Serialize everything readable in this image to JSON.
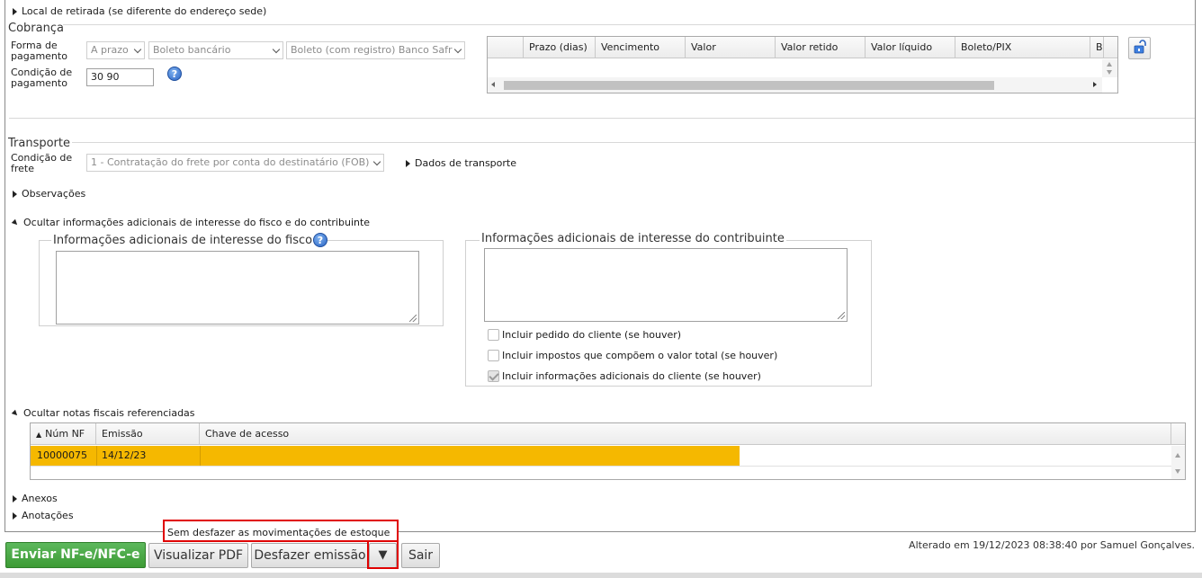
{
  "top_toggle": {
    "label": "Local de retirada (se diferente do endereço sede)"
  },
  "cobranca": {
    "title": "Cobrança",
    "forma_label": "Forma de pagamento",
    "forma_value": "A prazo",
    "tipo_value": "Boleto bancário",
    "banco_value": "Boleto (com registro) Banco Safr",
    "condicao_label": "Condição de pagamento",
    "condicao_value": "30 90",
    "help_icon": "question-icon",
    "columns": [
      "Prazo (dias)",
      "Vencimento",
      "Valor",
      "Valor retido",
      "Valor líquido",
      "Boleto/PIX",
      "B"
    ],
    "lock_icon": "lock-icon"
  },
  "transporte": {
    "title": "Transporte",
    "frete_label": "Condição de frete",
    "frete_value": "1 - Contratação do frete por conta do destinatário (FOB)",
    "dados_label": "Dados de transporte"
  },
  "observacoes": {
    "label": "Observações"
  },
  "info_adicionais": {
    "toggle_label": "Ocultar informações adicionais de interesse do fisco e do contribuinte",
    "fisco_title": "Informações adicionais de interesse do fisco",
    "contrib_title": "Informações adicionais de interesse do contribuinte",
    "checkboxes": [
      {
        "label": "Incluir pedido do cliente (se houver)",
        "checked": false
      },
      {
        "label": "Incluir impostos que compõem o valor total (se houver)",
        "checked": false
      },
      {
        "label": "Incluir informações adicionais do cliente (se houver)",
        "checked": true
      }
    ]
  },
  "notas_ref": {
    "toggle_label": "Ocultar notas fiscais referenciadas",
    "columns": [
      "Núm NF",
      "Emissão",
      "Chave de acesso"
    ],
    "rows": [
      {
        "num": "10000075",
        "emissao": "14/12/23",
        "chave": ""
      }
    ],
    "row_color": "#f5b800"
  },
  "anexos": {
    "label": "Anexos"
  },
  "anotacoes": {
    "label": "Anotações"
  },
  "dropdown_option": "Sem desfazer as movimentações de estoque",
  "footer": {
    "enviar": "Enviar NF-e/NFC-e",
    "visualizar": "Visualizar PDF",
    "desfazer": "Desfazer emissão",
    "dropdown_arrow": "▼",
    "sair": "Sair",
    "status": "Alterado em 19/12/2023 08:38:40 por Samuel Gonçalves."
  },
  "colors": {
    "accent_green": "#3d9b35",
    "highlight_red": "#e00000",
    "selected_row": "#f5b800"
  }
}
